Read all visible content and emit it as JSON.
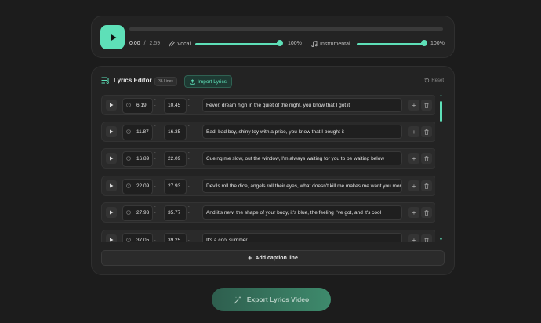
{
  "player": {
    "current_time": "0:00",
    "separator": "/",
    "duration": "2:59",
    "progress": 0.0,
    "vocal_label": "Vocal",
    "vocal_value": "100%",
    "vocal_level": 1.0,
    "instrumental_label": "Instrumental",
    "instrumental_value": "100%",
    "instrumental_level": 1.0
  },
  "editor": {
    "title": "Lyrics Editor",
    "lines_badge": "36 Lines",
    "import_label": "Import Lyrics",
    "reset_label": "Reset",
    "add_line_label": "Add caption line",
    "rows": [
      {
        "start": "6.19",
        "end": "10.45",
        "text": "Fever, dream high in the quiet of the night, you know that I got it"
      },
      {
        "start": "11.87",
        "end": "16.35",
        "text": "Bad, bad boy, shiny toy with a price, you know that I bought it"
      },
      {
        "start": "16.89",
        "end": "22.09",
        "text": "Cueing me slow, out the window, I'm always waiting for you to be waiting below"
      },
      {
        "start": "22.09",
        "end": "27.93",
        "text": "Devils roll the dice, angels roll their eyes, what doesn't kill me makes me want you more"
      },
      {
        "start": "27.93",
        "end": "35.77",
        "text": "And it's new, the shape of your body, it's blue, the feeling I've got, and it's cool"
      },
      {
        "start": "37.05",
        "end": "39.25",
        "text": "It's a cool summer."
      }
    ]
  },
  "export_label": "Export Lyrics Video",
  "colors": {
    "accent": "#5ee0b8",
    "background": "#1c1c1c",
    "card": "#232323"
  }
}
